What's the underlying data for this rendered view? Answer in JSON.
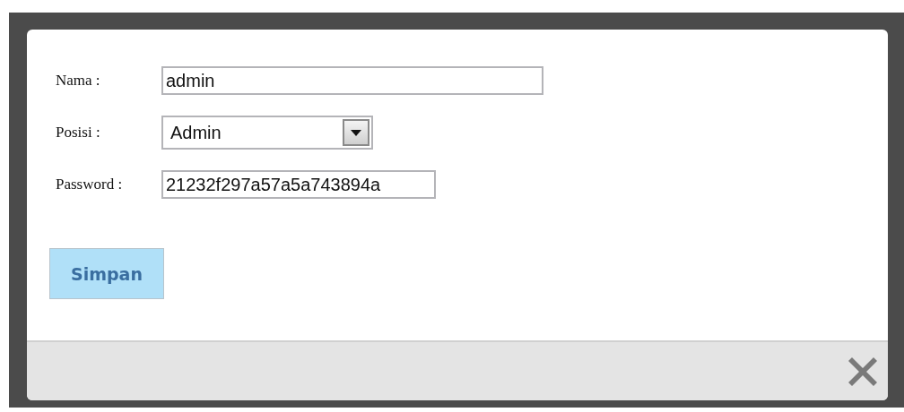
{
  "form": {
    "fields": [
      {
        "kind": "text",
        "label": "Nama :",
        "value": "admin"
      },
      {
        "kind": "select",
        "label": "Posisi :",
        "value": "Admin"
      },
      {
        "kind": "text",
        "label": "Password :",
        "value": "21232f297a57a5a743894a"
      }
    ]
  },
  "buttons": [
    "Simpan"
  ]
}
